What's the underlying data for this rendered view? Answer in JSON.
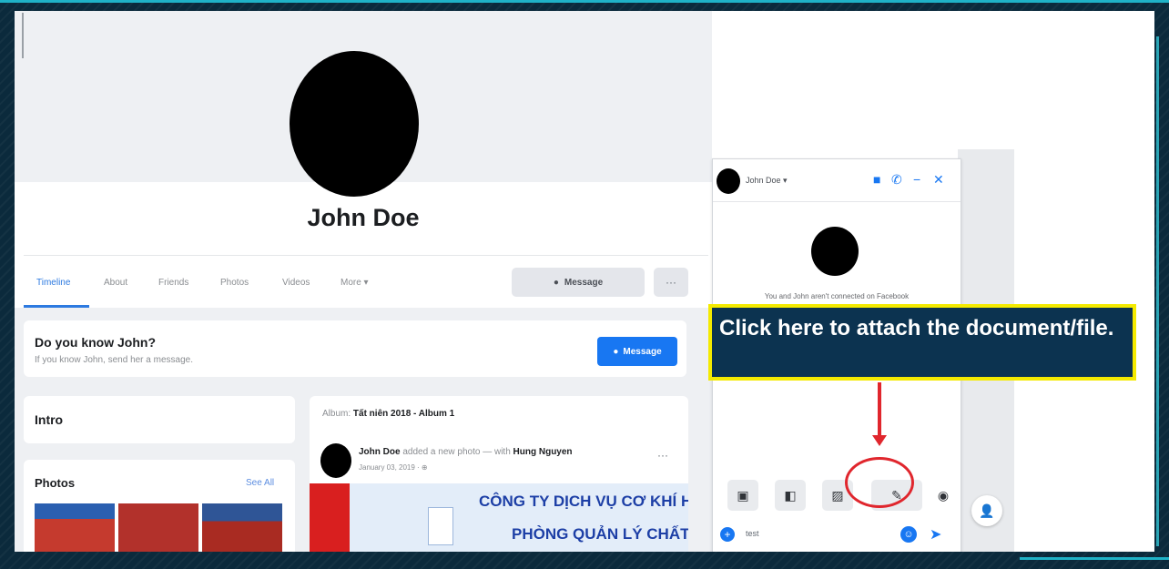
{
  "profile": {
    "name": "John Doe",
    "tabs": [
      "Timeline",
      "About",
      "Friends",
      "Photos",
      "Videos",
      "More ▾"
    ],
    "message_button": "Message",
    "more_button": "···"
  },
  "know_card": {
    "title": "Do you know John?",
    "subtitle": "If you know John, send her a message.",
    "button": "Message"
  },
  "intro": {
    "title": "Intro"
  },
  "photos": {
    "title": "Photos",
    "see_all": "See All"
  },
  "post": {
    "album_prefix": "Album:",
    "album_name": "Tất niên 2018 - Album 1",
    "author": "John Doe",
    "action": "added a new photo — with",
    "tagged": "Hung Nguyen",
    "date": "January 03, 2019 · ⊕",
    "banner_line1": "CÔNG TY DỊCH VỤ CƠ KHÍ HÀNG HẢI",
    "banner_line2": "PHÒNG QUẢN LÝ CHẤT LƯỢNG"
  },
  "chat": {
    "name": "John Doe ▾",
    "info": "You and John aren't connected on Facebook",
    "input_text": "test"
  },
  "callout": {
    "text": "Click here to attach the document/file."
  },
  "icons": {
    "video": "video-camera-icon",
    "phone": "phone-icon",
    "minimize": "minimize-icon",
    "close": "close-icon",
    "attach": "paperclip-icon"
  },
  "colors": {
    "facebook_blue": "#1877f2",
    "callout_bg": "#0c3350",
    "callout_border": "#f4ea00",
    "annotation_red": "#e0262d"
  }
}
